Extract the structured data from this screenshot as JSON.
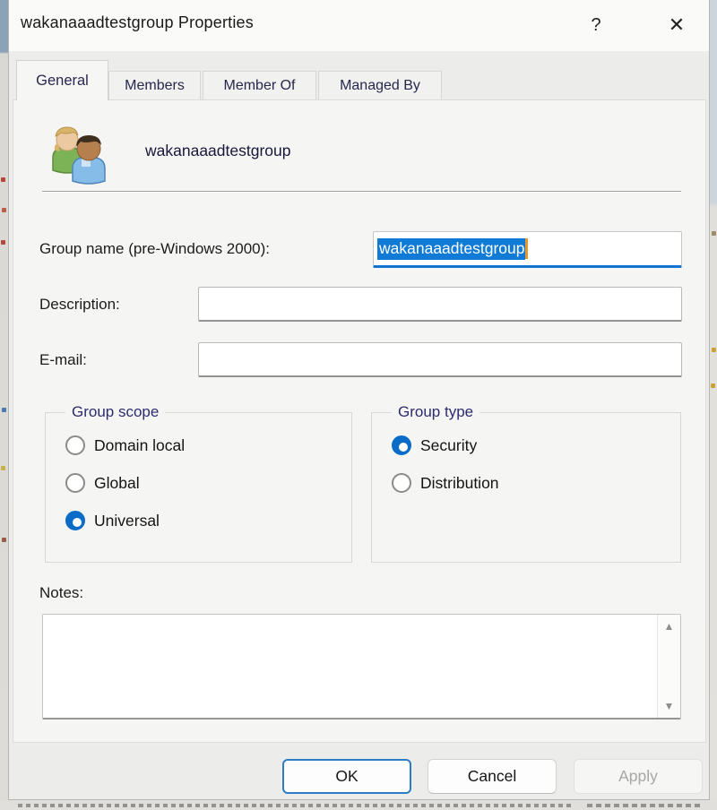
{
  "window": {
    "title": "wakanaaadtestgroup Properties",
    "icons": {
      "help": "?",
      "close": "✕",
      "scroll_up": "▲",
      "scroll_down": "▼"
    }
  },
  "tabs": [
    {
      "label": "General",
      "active": true
    },
    {
      "label": "Members",
      "active": false
    },
    {
      "label": "Member Of",
      "active": false
    },
    {
      "label": "Managed By",
      "active": false
    }
  ],
  "general": {
    "group_name": "wakanaaadtestgroup",
    "fields": {
      "pre_windows_label": "Group name (pre-Windows 2000):",
      "pre_windows_value": "wakanaaadtestgroup",
      "pre_windows_selected": true,
      "description_label": "Description:",
      "description_value": "",
      "email_label": "E-mail:",
      "email_value": "",
      "notes_label": "Notes:",
      "notes_value": ""
    },
    "group_scope": {
      "legend": "Group scope",
      "options": [
        {
          "label": "Domain local",
          "selected": false
        },
        {
          "label": "Global",
          "selected": false
        },
        {
          "label": "Universal",
          "selected": true
        }
      ]
    },
    "group_type": {
      "legend": "Group type",
      "options": [
        {
          "label": "Security",
          "selected": true
        },
        {
          "label": "Distribution",
          "selected": false
        }
      ]
    }
  },
  "buttons": {
    "ok": "OK",
    "cancel": "Cancel",
    "apply": "Apply",
    "apply_enabled": false
  },
  "colors": {
    "accent_blue": "#0b6cc8",
    "selection_blue": "#0f7bd7",
    "focus_underline": "#1173d2",
    "caret_orange": "#e8972f",
    "dialog_bg": "#ececeb",
    "page_bg": "#f5f5f4",
    "titlebar_bg": "#fafaf9"
  }
}
